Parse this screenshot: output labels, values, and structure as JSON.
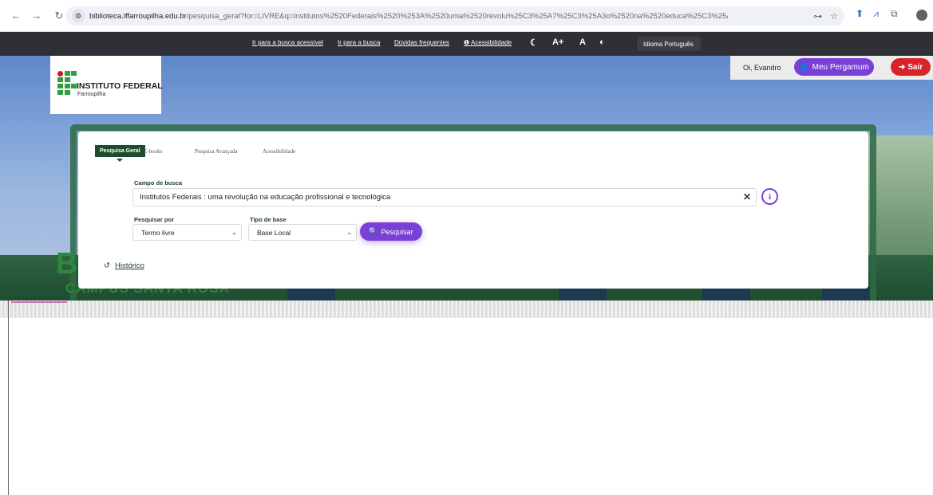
{
  "browser": {
    "url_host": "biblioteca.iffarroupilha.edu.br",
    "url_path": "/pesquisa_geral?for=LIVRE&q=Institutos%2520Federais%2520%253A%2520uma%2520revolu%25C3%25A7%25C3%25A3o%2520na%2520educa%25C3%25A7%25C3%25A3o%2520profissional%2520e%2520t..."
  },
  "accessibility_bar": {
    "links": [
      "Ir para a busca acessível",
      "Ir para a busca",
      "Dúvidas frequentes",
      "Acessibilidade"
    ],
    "font_plus": "A+",
    "font_normal": "A",
    "language": "Idioma Português"
  },
  "header": {
    "logo_title": "INSTITUTO FEDERAL",
    "logo_subtitle": "Farroupilha",
    "greeting": "Oi, Evandro",
    "meu_pergamum": "Meu Pergamum",
    "sair": "Sair",
    "hero_letter": "B",
    "hero_campus": "CAMPUS SANTA ROSA"
  },
  "search": {
    "tabs": [
      "Pesquisa Geral",
      "E-books",
      "Pesquisa Avançada",
      "Acessibilidade"
    ],
    "field_label": "Campo de busca",
    "field_value": "Institutos Federais : uma revolução na educação profissional e tecnológica",
    "search_by_label": "Pesquisar por",
    "search_by_value": "Termo livre",
    "base_label": "Tipo de base",
    "base_value": "Base Local",
    "button_label": "Pesquisar",
    "history_label": "Histórico"
  },
  "colors": {
    "accent_purple": "#7a3fd6",
    "sair_red": "#d9232a",
    "tab_green": "#1e4d2b",
    "brand_green": "#2f9e41"
  }
}
